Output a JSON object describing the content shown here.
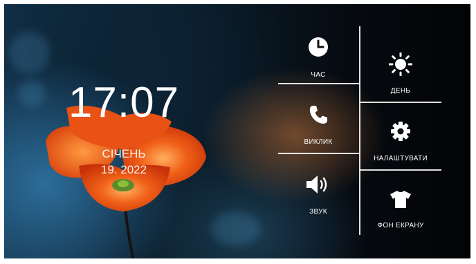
{
  "clock": {
    "time": "17:07",
    "month": "СІЧЕНЬ",
    "date": "19. 2022"
  },
  "menu": {
    "time": "ЧАС",
    "day": "ДЕНЬ",
    "call": "ВИКЛИК",
    "settings": "НАЛАШТУВАТИ",
    "sound": "ЗВУК",
    "wallpaper": "ФОН ЕКРАНУ"
  },
  "icons": [
    "clock-icon",
    "sun-icon",
    "phone-icon",
    "gear-icon",
    "speaker-icon",
    "shirt-icon"
  ],
  "colors": {
    "icon": "#ffffff",
    "petal": "#f05a14",
    "stem": "#141414"
  }
}
